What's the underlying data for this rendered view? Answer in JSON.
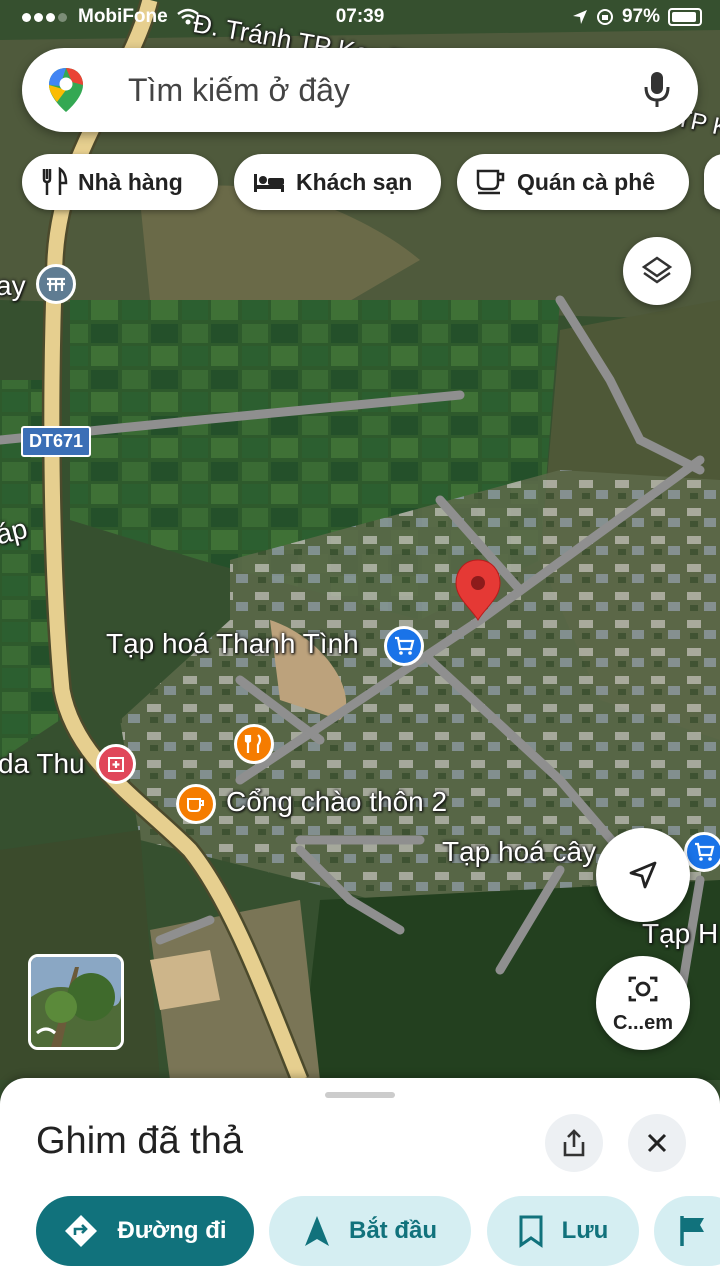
{
  "status_bar": {
    "carrier": "MobiFone",
    "time": "07:39",
    "battery": "97%"
  },
  "search": {
    "placeholder": "Tìm kiếm ở đây"
  },
  "chips": [
    {
      "label": "Nhà hàng",
      "icon": "restaurant-icon"
    },
    {
      "label": "Khách sạn",
      "icon": "hotel-icon"
    },
    {
      "label": "Quán cà phê",
      "icon": "coffee-icon"
    }
  ],
  "map": {
    "street_label": "Đ. Tránh TP Kon T",
    "street_label_right": "TP K",
    "road_badge": "DT671",
    "labels": {
      "left_edge_top": "ay",
      "left_edge_mid": "áp",
      "left_edge_bottom": "da Thu",
      "store_1": "Tạp hoá Thanh Tình",
      "gate": "Cổng chào thôn 2",
      "store_2": "Tạp hoá cây",
      "store_3": "Tạp H"
    },
    "colors": {
      "pin": "#e53935",
      "shopping_poi": "#1a73e8",
      "food_poi": "#f57c00",
      "medical_poi": "#e0475a"
    }
  },
  "floating": {
    "camera_label": "C...em"
  },
  "sheet": {
    "title": "Ghim đã thả",
    "actions": [
      {
        "label": "Đường đi",
        "icon": "directions-icon"
      },
      {
        "label": "Bắt đầu",
        "icon": "navigation-arrow-icon"
      },
      {
        "label": "Lưu",
        "icon": "bookmark-icon"
      }
    ]
  }
}
